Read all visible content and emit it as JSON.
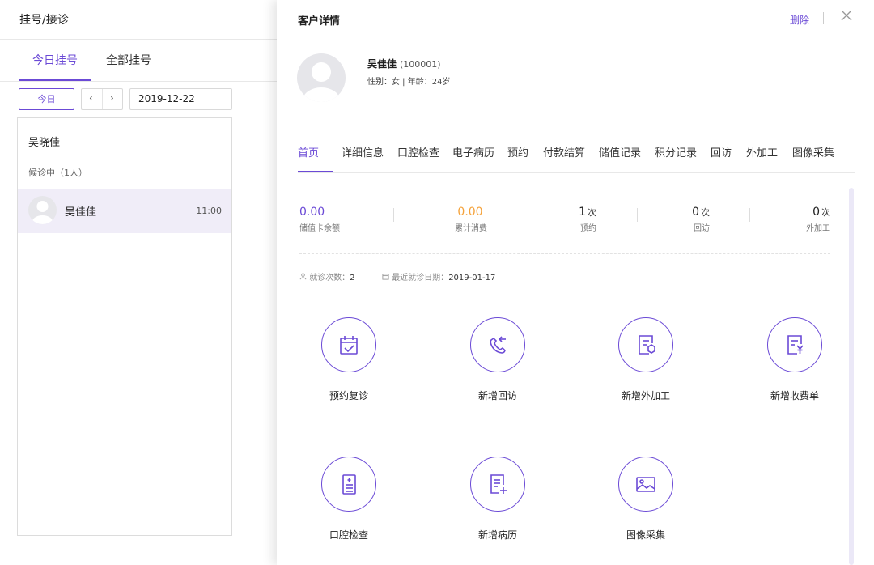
{
  "left": {
    "title": "挂号/接诊",
    "tabs": [
      {
        "label": "今日挂号",
        "active": true
      },
      {
        "label": "全部挂号",
        "active": false
      }
    ],
    "today_button": "今日",
    "prev_icon": "chevron-left-icon",
    "next_icon": "chevron-right-icon",
    "date_value": "2019-12-22",
    "list": {
      "doctor_name": "吴晓佳",
      "waiting_text": "候诊中（1人）",
      "patients": [
        {
          "name": "吴佳佳",
          "time": "11:00"
        }
      ]
    }
  },
  "right": {
    "title": "客户详情",
    "delete_label": "删除",
    "close_icon": "close-icon",
    "customer": {
      "name": "吴佳佳",
      "id": "(100001)",
      "meta": "性别：女  |  年龄：24岁"
    },
    "tabs": [
      "首页",
      "详细信息",
      "口腔检查",
      "电子病历",
      "预约",
      "付款结算",
      "储值记录",
      "积分记录",
      "回访",
      "外加工",
      "图像采集"
    ],
    "active_tab": "首页",
    "stats": [
      {
        "value": "0.00",
        "unit": "",
        "label": "储值卡余额",
        "color": "#6b4ad6"
      },
      {
        "value": "0.00",
        "unit": "",
        "label": "累计消费",
        "color": "#f5a23a"
      },
      {
        "value": "1",
        "unit": "次",
        "label": "预约",
        "color": "#222222"
      },
      {
        "value": "0",
        "unit": "次",
        "label": "回访",
        "color": "#222222"
      },
      {
        "value": "0",
        "unit": "次",
        "label": "外加工",
        "color": "#222222"
      }
    ],
    "visit_count_label": "就诊次数：",
    "visit_count": "2",
    "last_visit_label": "最近就诊日期：",
    "last_visit_date": "2019-01-17",
    "actions": [
      {
        "label": "预约复诊",
        "icon": "calendar-check-icon"
      },
      {
        "label": "新增回访",
        "icon": "phone-callback-icon"
      },
      {
        "label": "新增外加工",
        "icon": "document-hexagon-icon"
      },
      {
        "label": "新增收费单",
        "icon": "document-yen-icon"
      },
      {
        "label": "口腔检查",
        "icon": "clipboard-list-icon"
      },
      {
        "label": "新增病历",
        "icon": "document-add-icon"
      },
      {
        "label": "图像采集",
        "icon": "image-icon"
      }
    ]
  },
  "colors": {
    "accent": "#6b4ad6",
    "orange": "#f5a23a"
  }
}
